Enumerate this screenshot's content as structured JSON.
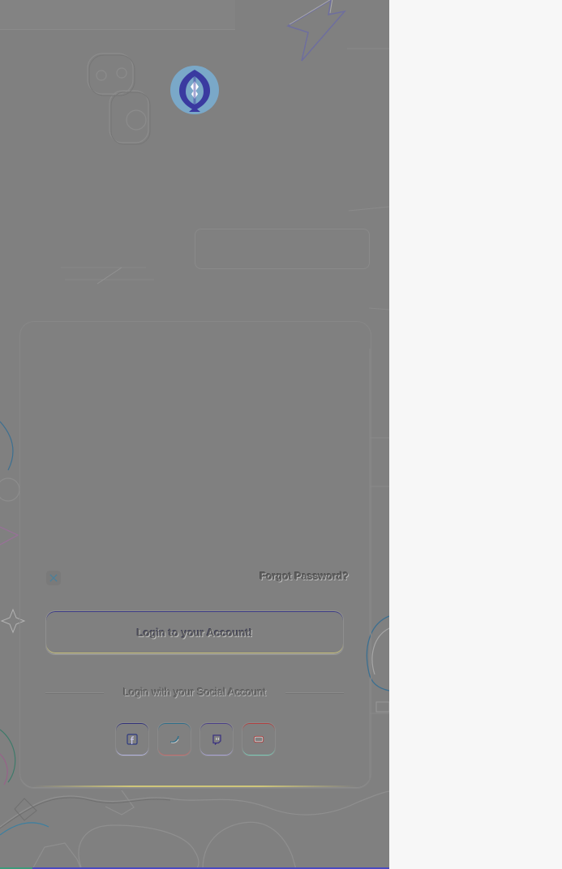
{
  "login": {
    "forgot_password": "Forgot Password?",
    "login_button": "Login to your Account!",
    "social_divider": "Login with your Social Account"
  },
  "social": [
    {
      "name": "facebook-icon"
    },
    {
      "name": "twitter-icon"
    },
    {
      "name": "twitch-icon"
    },
    {
      "name": "youtube-icon"
    }
  ],
  "colors": {
    "background": "#808080",
    "right_pane": "#f7f7f7",
    "logo_primary": "#3a3aa0",
    "logo_secondary": "#7aa8c8",
    "accent_gold": "#cfc67a"
  }
}
